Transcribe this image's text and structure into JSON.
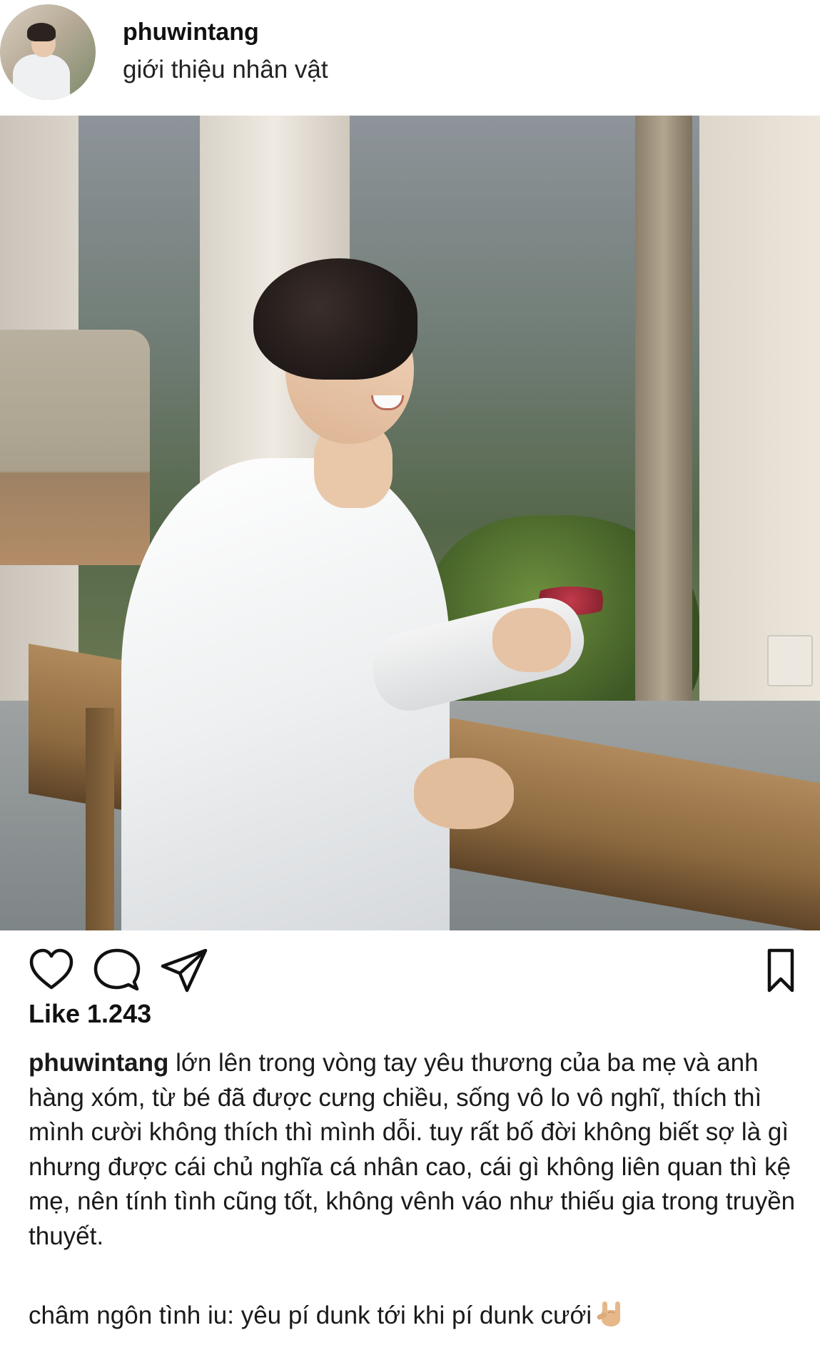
{
  "header": {
    "username": "phuwintang",
    "subtitle": "giới thiệu nhân vật"
  },
  "post": {
    "likes_text": "Like 1.243",
    "caption_user": "phuwintang",
    "caption_text": "lớn lên trong vòng tay yêu thương của ba mẹ và anh hàng xóm, từ bé đã được cưng chiều, sống vô lo vô nghĩ, thích thì mình cười không thích thì mình dỗi. tuy rất bố đời không biết sợ là gì nhưng được cái chủ nghĩa cá nhân cao, cái gì không liên quan thì kệ mẹ, nên tính tình cũng tốt, không vênh váo như thiếu gia trong truyền thuyết.",
    "motto_text": "châm ngôn tình iu: yêu pí dunk tới khi pí dunk cưới",
    "motto_emoji": "love-you-gesture-icon"
  },
  "actions": {
    "icons": [
      "heart-icon",
      "comment-icon",
      "share-icon",
      "bookmark-icon"
    ]
  },
  "colors": {
    "text": "#111111",
    "background": "#ffffff"
  }
}
